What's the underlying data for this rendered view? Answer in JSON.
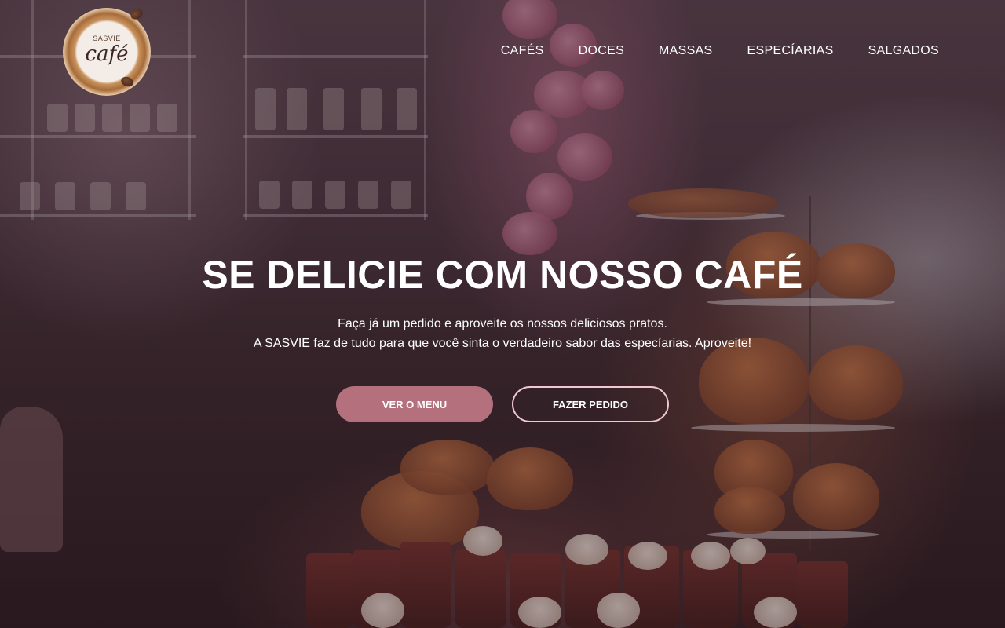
{
  "brand": {
    "logo_small": "SASVIÉ",
    "logo_big": "café"
  },
  "nav": {
    "items": [
      {
        "label": "CAFÉS"
      },
      {
        "label": "DOCES"
      },
      {
        "label": "MASSAS"
      },
      {
        "label": "ESPECÍARIAS"
      },
      {
        "label": "SALGADOS"
      }
    ]
  },
  "hero": {
    "headline": "SE DELICIE COM NOSSO CAFÉ",
    "line1": "Faça já um pedido e aproveite os nossos deliciosos pratos.",
    "line2": "A SASVIE faz de tudo para que você sinta o verdadeiro sabor das especíarias. Aproveite!",
    "primary_button": "VER O MENU",
    "secondary_button": "FAZER PEDIDO"
  },
  "colors": {
    "primary_button": "#b4707d",
    "outline_border": "#f1c8d2"
  }
}
